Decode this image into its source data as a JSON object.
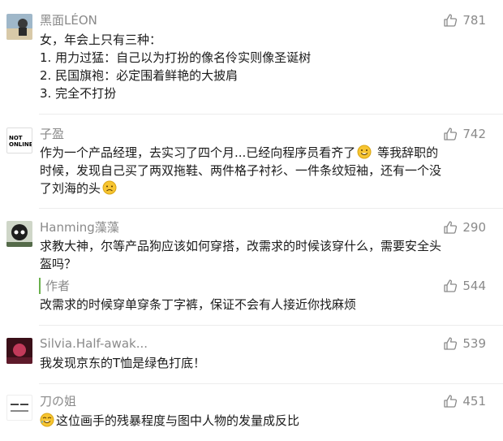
{
  "comments": [
    {
      "author": "黑面LÉON",
      "likes": "781",
      "lines": [
        "女，年会上只有三种：",
        "1. 用力过猛：自己以为打扮的像名伶实则像圣诞树",
        "2. 民国旗袍：必定围着鲜艳的大披肩",
        "3. 完全不打扮"
      ]
    },
    {
      "author": "子盈",
      "avatar_text": [
        "NOT",
        "ONLINE"
      ],
      "likes": "742",
      "line1": "作为一个产品经理，去实习了四个月...已经向程序员看齐了",
      "line1_after": "等我辞职的",
      "line2": "时候，发现自己买了两双拖鞋、两件格子衬衫、一件条纹短袖，还有一个没",
      "line3": "了刘海的头"
    },
    {
      "author": "Hanming藻藻",
      "likes": "290",
      "lines": [
        "求教大神，尔等产品狗应该如何穿搭，改需求的时候该穿什么，需要安全头",
        "盔吗？"
      ],
      "reply": {
        "tag": "作者",
        "likes": "544",
        "text": "改需求的时候穿单穿条丁字裤，保证不会有人接近你找麻烦"
      }
    },
    {
      "author": "Silvia.Half-awak...",
      "likes": "539",
      "lines": [
        "我发现京东的T恤是绿色打底！"
      ]
    },
    {
      "author": "刀の姐",
      "likes": "451",
      "text": "这位画手的残暴程度与图中人物的发量成反比"
    }
  ],
  "colors": {
    "meta": "#8a8a8a",
    "body": "#1a1a1a",
    "author_bar": "#6ab04c"
  }
}
